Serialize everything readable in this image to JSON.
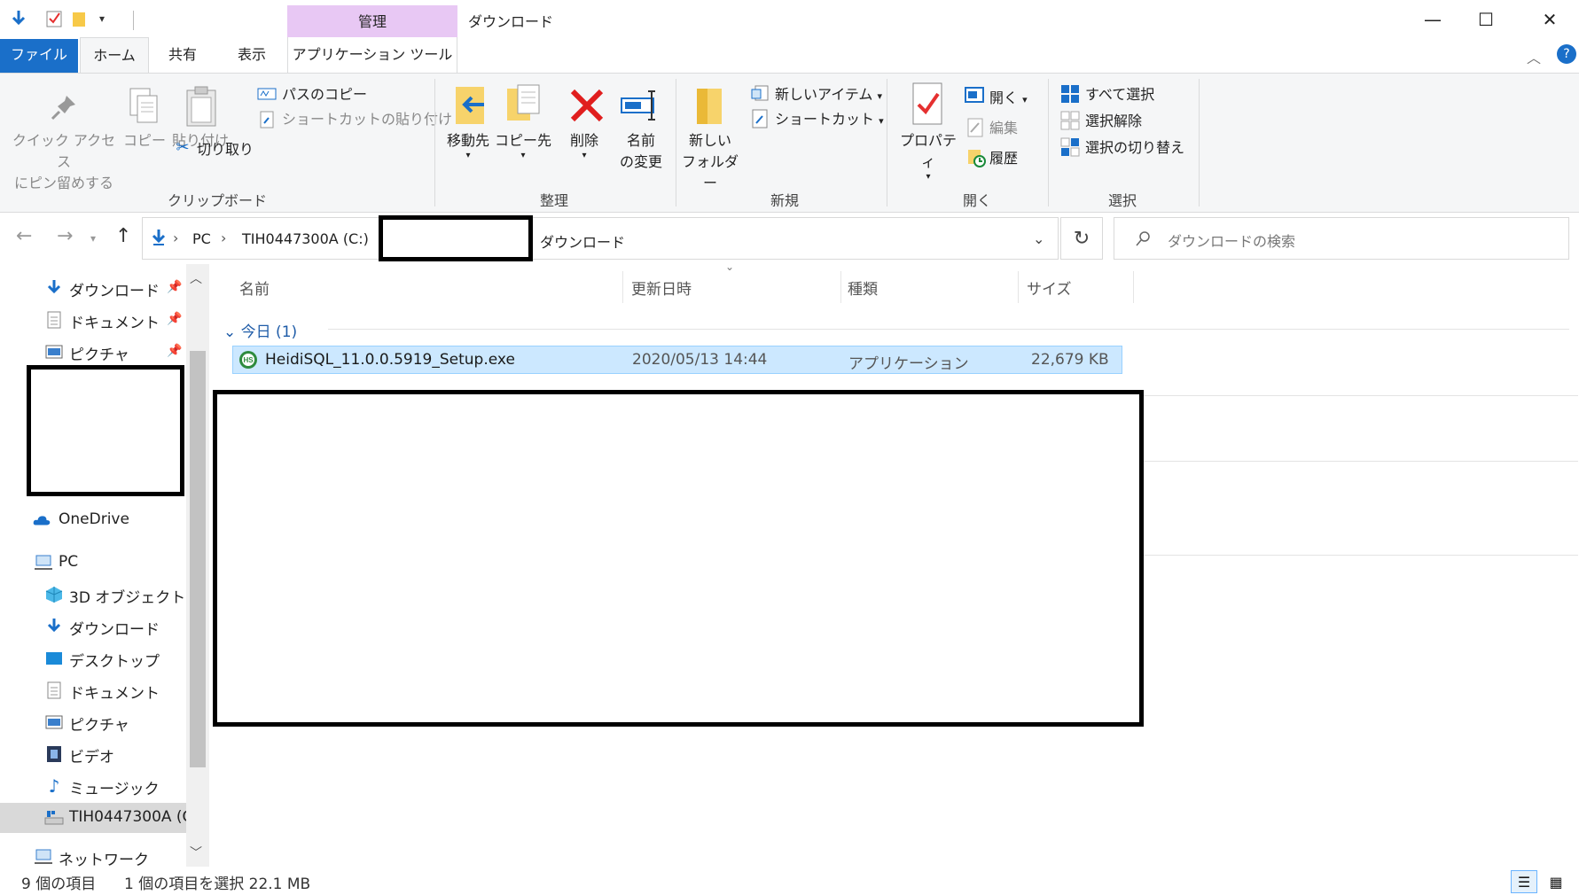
{
  "window": {
    "title": "ダウンロード",
    "manage_tab": "管理",
    "minimize": "—",
    "maximize": "☐",
    "close": "✕"
  },
  "ribbon_tabs": {
    "file": "ファイル",
    "home": "ホーム",
    "share": "共有",
    "view": "表示",
    "app_tools": "アプリケーション ツール"
  },
  "clipboard": {
    "pin_line1": "クイック アクセス",
    "pin_line2": "にピン留めする",
    "copy": "コピー",
    "paste": "貼り付け",
    "copy_path": "パスのコピー",
    "paste_shortcut": "ショートカットの貼り付け",
    "cut": "切り取り",
    "group": "クリップボード"
  },
  "organize": {
    "move_to": "移動先",
    "copy_to": "コピー先",
    "delete": "削除",
    "rename_line1": "名前",
    "rename_line2": "の変更",
    "group": "整理"
  },
  "new": {
    "new_folder_line1": "新しい",
    "new_folder_line2": "フォルダー",
    "new_item": "新しいアイテム",
    "shortcut": "ショートカット",
    "group": "新規"
  },
  "open": {
    "properties": "プロパティ",
    "open": "開く",
    "edit": "編集",
    "history": "履歴",
    "group": "開く"
  },
  "select": {
    "select_all": "すべて選択",
    "select_none": "選択解除",
    "invert": "選択の切り替え",
    "group": "選択"
  },
  "address": {
    "pc": "PC",
    "drive": "TIH0447300A (C:)",
    "folder": "ダウンロード",
    "search_placeholder": "ダウンロードの検索"
  },
  "nav_pane": {
    "quick": [
      {
        "label": "ダウンロード",
        "icon": "download-arrow-icon"
      },
      {
        "label": "ドキュメント",
        "icon": "document-icon"
      },
      {
        "label": "ピクチャ",
        "icon": "pictures-icon"
      }
    ],
    "onedrive": "OneDrive",
    "pc": "PC",
    "pc_items": [
      {
        "label": "3D オブジェクト",
        "icon": "cube-icon"
      },
      {
        "label": "ダウンロード",
        "icon": "download-arrow-icon"
      },
      {
        "label": "デスクトップ",
        "icon": "desktop-icon"
      },
      {
        "label": "ドキュメント",
        "icon": "document-icon"
      },
      {
        "label": "ピクチャ",
        "icon": "pictures-icon"
      },
      {
        "label": "ビデオ",
        "icon": "video-icon"
      },
      {
        "label": "ミュージック",
        "icon": "music-icon"
      },
      {
        "label": "TIH0447300A (C",
        "icon": "drive-icon"
      }
    ],
    "network": "ネットワーク"
  },
  "file_list": {
    "columns": {
      "name": "名前",
      "modified": "更新日時",
      "type": "種類",
      "size": "サイズ"
    },
    "group": "今日 (1)",
    "rows": [
      {
        "name": "HeidiSQL_11.0.0.5919_Setup.exe",
        "modified": "2020/05/13 14:44",
        "type": "アプリケーション",
        "size": "22,679 KB"
      }
    ]
  },
  "status": {
    "count": "9 個の項目",
    "selection": "1 個の項目を選択  22.1 MB"
  },
  "colors": {
    "file_tab": "#1a6fc9",
    "manage_tab": "#e8c8f4",
    "selection": "#cce8ff",
    "group_header": "#1f5ca8"
  }
}
